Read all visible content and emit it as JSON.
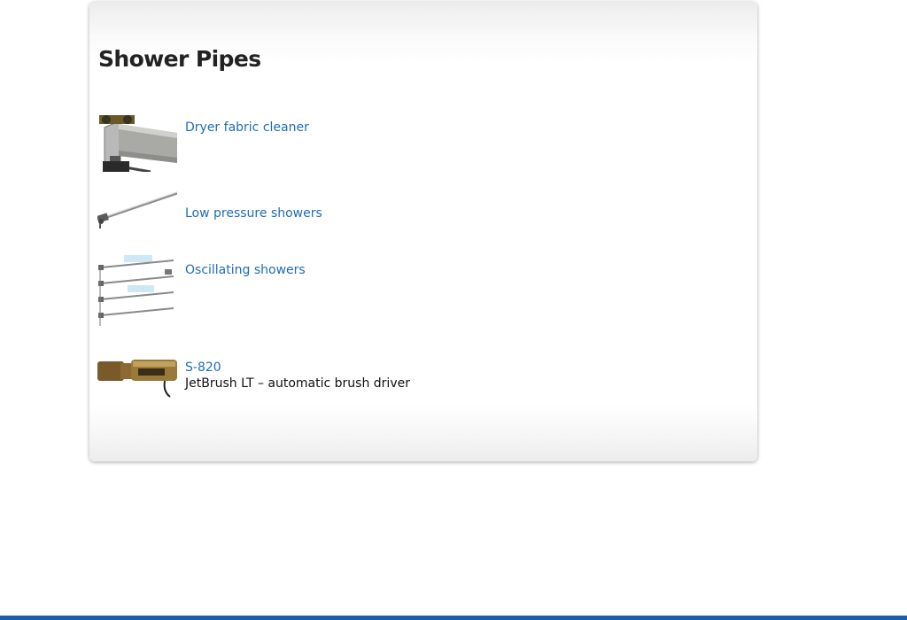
{
  "page": {
    "title": "Shower Pipes"
  },
  "products": [
    {
      "name": "Dryer fabric cleaner",
      "description": "",
      "image_icon": "dryer-fabric-cleaner-thumbnail"
    },
    {
      "name": "Low pressure showers",
      "description": "",
      "image_icon": "low-pressure-shower-thumbnail"
    },
    {
      "name": "Oscillating showers",
      "description": "",
      "image_icon": "oscillating-showers-thumbnail"
    },
    {
      "name": "S-820",
      "description": "JetBrush LT – automatic brush driver",
      "image_icon": "jetbrush-thumbnail"
    }
  ],
  "colors": {
    "link": "#1f6db6",
    "heading": "#222222",
    "footer_bar": "#1a5fa8"
  }
}
